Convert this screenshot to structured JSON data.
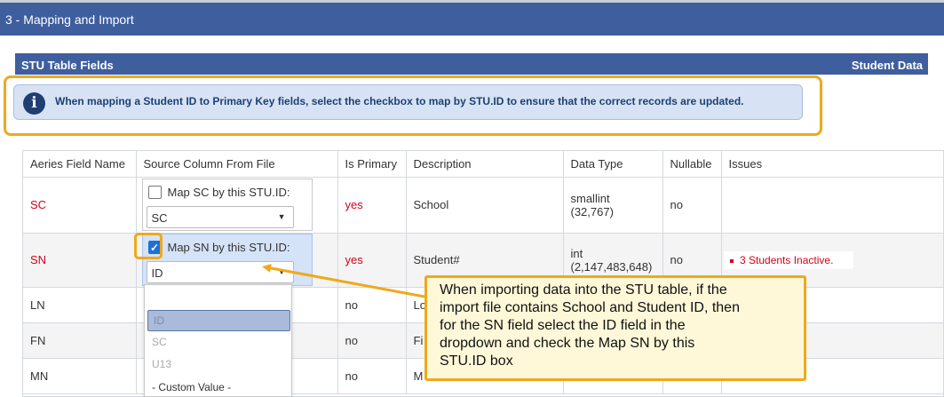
{
  "section": {
    "title": "3 - Mapping and Import"
  },
  "panel": {
    "title": "STU Table Fields",
    "right_label": "Student Data"
  },
  "info": {
    "text": "When mapping a Student ID to Primary Key fields, select the checkbox to map by STU.ID to ensure that the correct records are updated."
  },
  "table": {
    "headers": [
      "Aeries Field Name",
      "Source Column From File",
      "Is Primary",
      "Description",
      "Data Type",
      "Nullable",
      "Issues"
    ],
    "rows": [
      {
        "field": "SC",
        "checkbox_label": "Map SC by this STU.ID:",
        "checked": false,
        "select_value": "SC",
        "is_primary": "yes",
        "description": "School",
        "data_type_line1": "smallint",
        "data_type_line2": "(32,767)",
        "nullable": "no",
        "issues": ""
      },
      {
        "field": "SN",
        "checkbox_label": "Map SN by this STU.ID:",
        "checked": true,
        "select_value": "ID",
        "is_primary": "yes",
        "description": "Student#",
        "data_type_line1": "int",
        "data_type_line2": "(2,147,483,648)",
        "nullable": "no",
        "issues": "3 Students Inactive."
      },
      {
        "field": "LN",
        "is_primary": "no",
        "description": "Lo"
      },
      {
        "field": "FN",
        "is_primary": "no",
        "description": "Fi"
      },
      {
        "field": "MN",
        "is_primary": "no",
        "description": "M"
      }
    ]
  },
  "dropdown": {
    "options": [
      "ID",
      "SC",
      "U13",
      "- Custom Value -"
    ],
    "highlighted": "ID"
  },
  "callout": {
    "lines": [
      "When importing data into the STU table, if the",
      "import file contains School and Student ID, then",
      "for the SN field select the ID field in the",
      "dropdown and check the Map SN by this",
      "STU.ID box"
    ]
  },
  "colors": {
    "header_blue": "#3e5e9e",
    "highlight_orange": "#f0a81c",
    "error_red": "#d0021b"
  },
  "icons": {
    "info": "info-icon",
    "checkmark": "checkmark-icon",
    "dropdown_arrow": "chevron-down-icon"
  }
}
